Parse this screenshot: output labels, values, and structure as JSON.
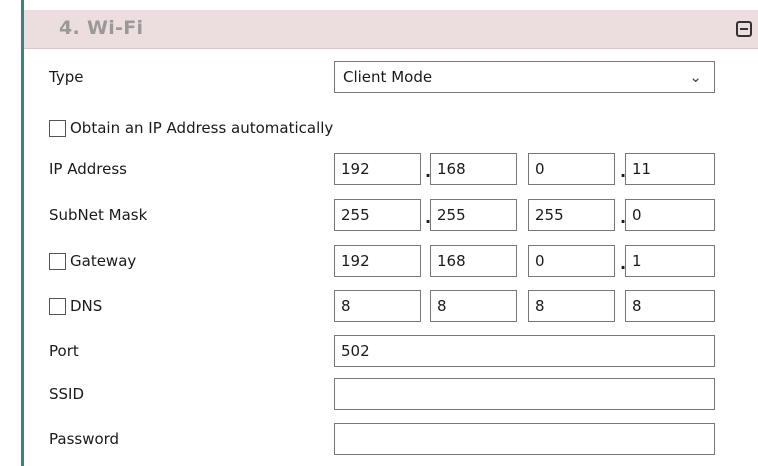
{
  "section": {
    "title": "4. Wi-Fi",
    "collapse_icon": "minus-square-icon"
  },
  "type": {
    "label": "Type",
    "value": "Client Mode"
  },
  "obtain_ip": {
    "label": "Obtain an IP Address automatically",
    "checked": false
  },
  "ip_address": {
    "label": "IP Address",
    "octets": [
      "192",
      "168",
      "0",
      "11"
    ]
  },
  "subnet_mask": {
    "label": "SubNet Mask",
    "octets": [
      "255",
      "255",
      "255",
      "0"
    ]
  },
  "gateway": {
    "label": "Gateway",
    "checked": false,
    "octets": [
      "192",
      "168",
      "0",
      "1"
    ]
  },
  "dns": {
    "label": "DNS",
    "checked": false,
    "octets": [
      "8",
      "8",
      "8",
      "8"
    ]
  },
  "port": {
    "label": "Port",
    "value": "502"
  },
  "ssid": {
    "label": "SSID",
    "value": ""
  },
  "password": {
    "label": "Password",
    "value": ""
  },
  "dot_separator": "."
}
